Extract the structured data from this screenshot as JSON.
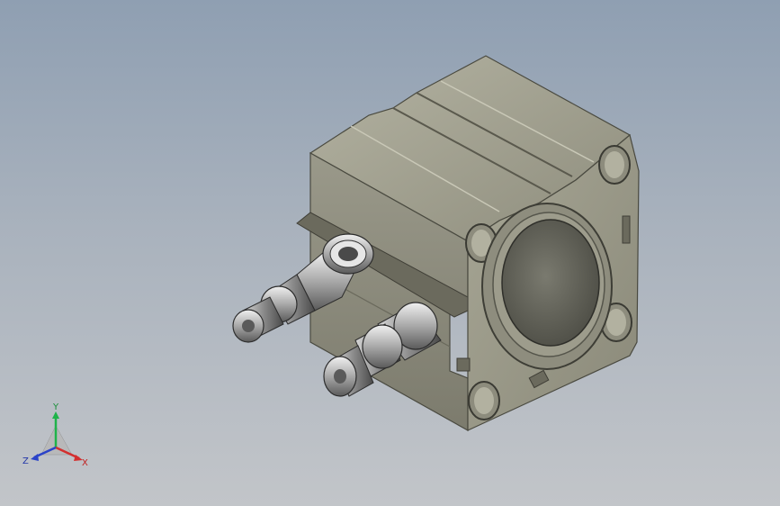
{
  "viewport": {
    "background_top": "#8f9fb2",
    "background_bottom": "#c2c5c9"
  },
  "model": {
    "body_color": "#a3a291",
    "body_shadow": "#6f6e60",
    "fitting_color": "#b9b9b9"
  },
  "triad": {
    "y_label": "Y",
    "x_label": "X",
    "z_label": "Z",
    "y_color": "#1fb34a",
    "x_color": "#d32f2f",
    "z_color": "#2a43c9"
  }
}
